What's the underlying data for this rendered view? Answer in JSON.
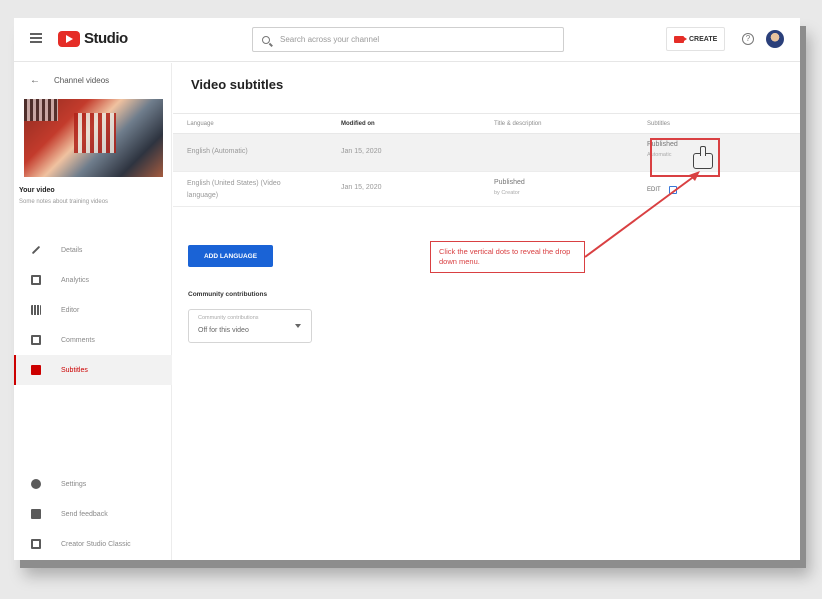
{
  "app": {
    "logo_text": "Studio",
    "search_placeholder": "Search across your channel",
    "create_label": "CREATE",
    "help_glyph": "?"
  },
  "sidebar": {
    "back_label": "Channel videos",
    "your_video_label": "Your video",
    "video_description": "Some notes about training videos",
    "nav": [
      {
        "label": "Details",
        "icon": "pencil-icon"
      },
      {
        "label": "Analytics",
        "icon": "analytics-icon"
      },
      {
        "label": "Editor",
        "icon": "editor-icon"
      },
      {
        "label": "Comments",
        "icon": "comments-icon"
      },
      {
        "label": "Subtitles",
        "icon": "subtitles-icon",
        "active": true
      }
    ],
    "bottom_nav": [
      {
        "label": "Settings",
        "icon": "gear-icon"
      },
      {
        "label": "Send feedback",
        "icon": "feedback-icon"
      },
      {
        "label": "Creator Studio Classic",
        "icon": "classic-icon"
      }
    ]
  },
  "main": {
    "title": "Video subtitles",
    "columns": [
      "Language",
      "Modified on",
      "Title & description",
      "Subtitles"
    ],
    "rows": [
      {
        "language": "English (Automatic)",
        "modified": "Jan 15, 2020",
        "title_desc": "",
        "subtitles_status": "Published",
        "subtitles_sub": "Automatic"
      },
      {
        "language": "English (United States) (Video language)",
        "modified": "Jan 15, 2020",
        "title_desc": "Published",
        "title_desc_sub": "by Creator",
        "subtitles_edit": "EDIT"
      }
    ],
    "add_language_label": "ADD LANGUAGE",
    "community_label": "Community contributions",
    "community_select": {
      "label": "Community contributions",
      "value": "Off for this video"
    }
  },
  "annotation": {
    "callout_text": "Click the vertical dots to reveal the drop down menu.",
    "color": "#d94042"
  }
}
